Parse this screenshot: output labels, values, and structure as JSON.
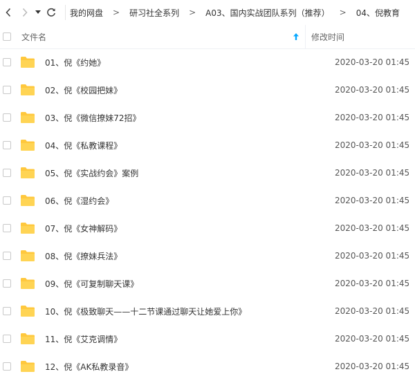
{
  "toolbar": {
    "breadcrumb": [
      "我的网盘",
      "研习社全系列",
      "A03、国内实战团队系列（推荐）",
      "04、倪教育"
    ],
    "separator": ">"
  },
  "header": {
    "name_label": "文件名",
    "time_label": "修改时间"
  },
  "colors": {
    "folder": "#ffc83d",
    "accent": "#06a7ff"
  },
  "files": [
    {
      "name": "01、倪《约她》",
      "modified": "2020-03-20 01:45"
    },
    {
      "name": "02、倪《校园把妹》",
      "modified": "2020-03-20 01:45"
    },
    {
      "name": "03、倪《微信撩妹72招》",
      "modified": "2020-03-20 01:45"
    },
    {
      "name": "04、倪《私教课程》",
      "modified": "2020-03-20 01:45"
    },
    {
      "name": "05、倪《实战约会》案例",
      "modified": "2020-03-20 01:45"
    },
    {
      "name": "06、倪《湿约会》",
      "modified": "2020-03-20 01:45"
    },
    {
      "name": "07、倪《女神解码》",
      "modified": "2020-03-20 01:45"
    },
    {
      "name": "08、倪《撩妹兵法》",
      "modified": "2020-03-20 01:45"
    },
    {
      "name": "09、倪《可复制聊天课》",
      "modified": "2020-03-20 01:45"
    },
    {
      "name": "10、倪《极致聊天——十二节课通过聊天让她爱上你》",
      "modified": "2020-03-20 01:45"
    },
    {
      "name": "11、倪《艾克调情》",
      "modified": "2020-03-20 01:45"
    },
    {
      "name": "12、倪《AK私教录音》",
      "modified": "2020-03-20 01:45"
    }
  ]
}
